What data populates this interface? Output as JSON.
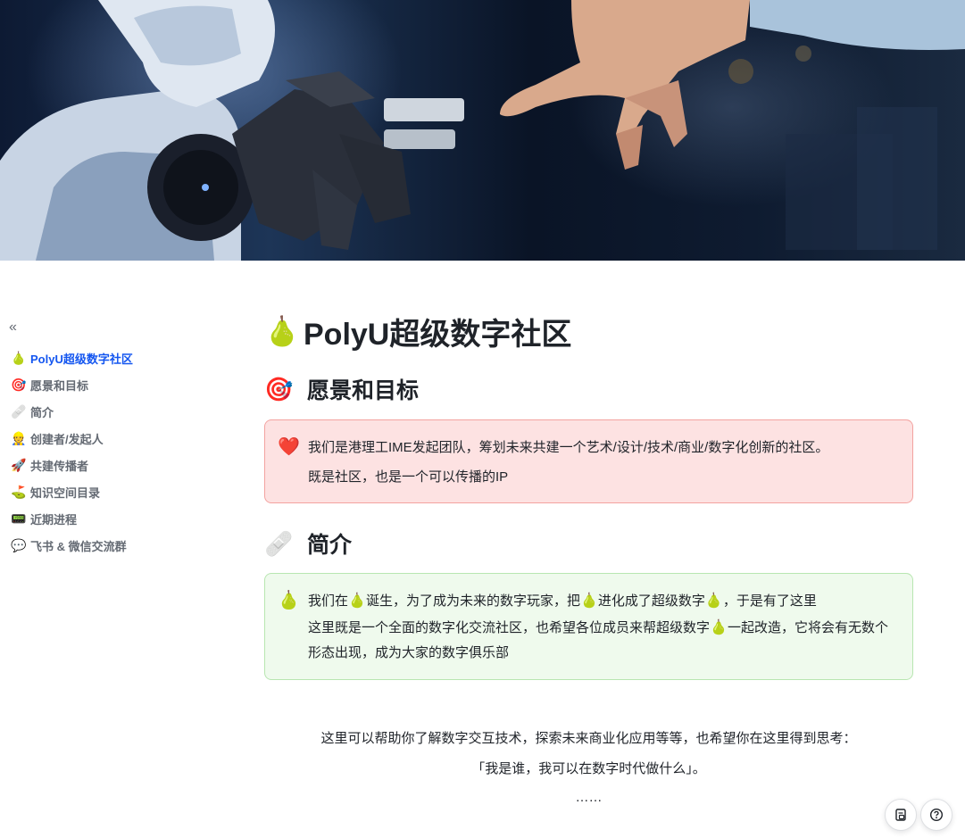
{
  "cover": {
    "icon": "robot-arm-and-hand-cover-image"
  },
  "toc": {
    "collapse_icon": "«",
    "items": [
      {
        "emoji": "🍐",
        "label": "PolyU超级数字社区",
        "active": true
      },
      {
        "emoji": "🎯",
        "label": "愿景和目标"
      },
      {
        "emoji": "🩹",
        "label": "简介"
      },
      {
        "emoji": "👷",
        "label": "创建者/发起人"
      },
      {
        "emoji": "🚀",
        "label": "共建传播者"
      },
      {
        "emoji": "⛳",
        "label": "知识空间目录"
      },
      {
        "emoji": "📟",
        "label": "近期进程"
      },
      {
        "emoji": "💬",
        "label": "飞书 & 微信交流群"
      }
    ]
  },
  "doc": {
    "title_emoji": "🍐",
    "title": "PolyU超级数字社区",
    "vision": {
      "emoji": "🎯",
      "heading": "愿景和目标",
      "callout_emoji": "❤️",
      "line1": "我们是港理工IME发起团队，筹划未来共建一个艺术/设计/技术/商业/数字化创新的社区。",
      "line2": "既是社区，也是一个可以传播的IP"
    },
    "intro": {
      "emoji": "🩹",
      "heading": "简介",
      "callout_emoji": "🍐",
      "pear": "🍐",
      "l1a": "我们在",
      "l1b": "诞生，为了成为未来的数字玩家，把",
      "l1c": "进化成了超级数字",
      "l1d": "，于是有了这里",
      "l2a": "这里既是一个全面的数字化交流社区，也希望各位成员来帮超级数字",
      "l2b": "一起改造，它将会有无数个形态出现，成为大家的数字俱乐部"
    },
    "closing": {
      "line1": "这里可以帮助你了解数字交互技术，探索未来商业化应用等等，也希望你在这里得到思考：",
      "line2": "「我是谁，我可以在数字时代做什么」。",
      "line3": "……"
    }
  },
  "fabs": {
    "left_icon": "document-info-icon",
    "right_icon": "help-icon"
  }
}
